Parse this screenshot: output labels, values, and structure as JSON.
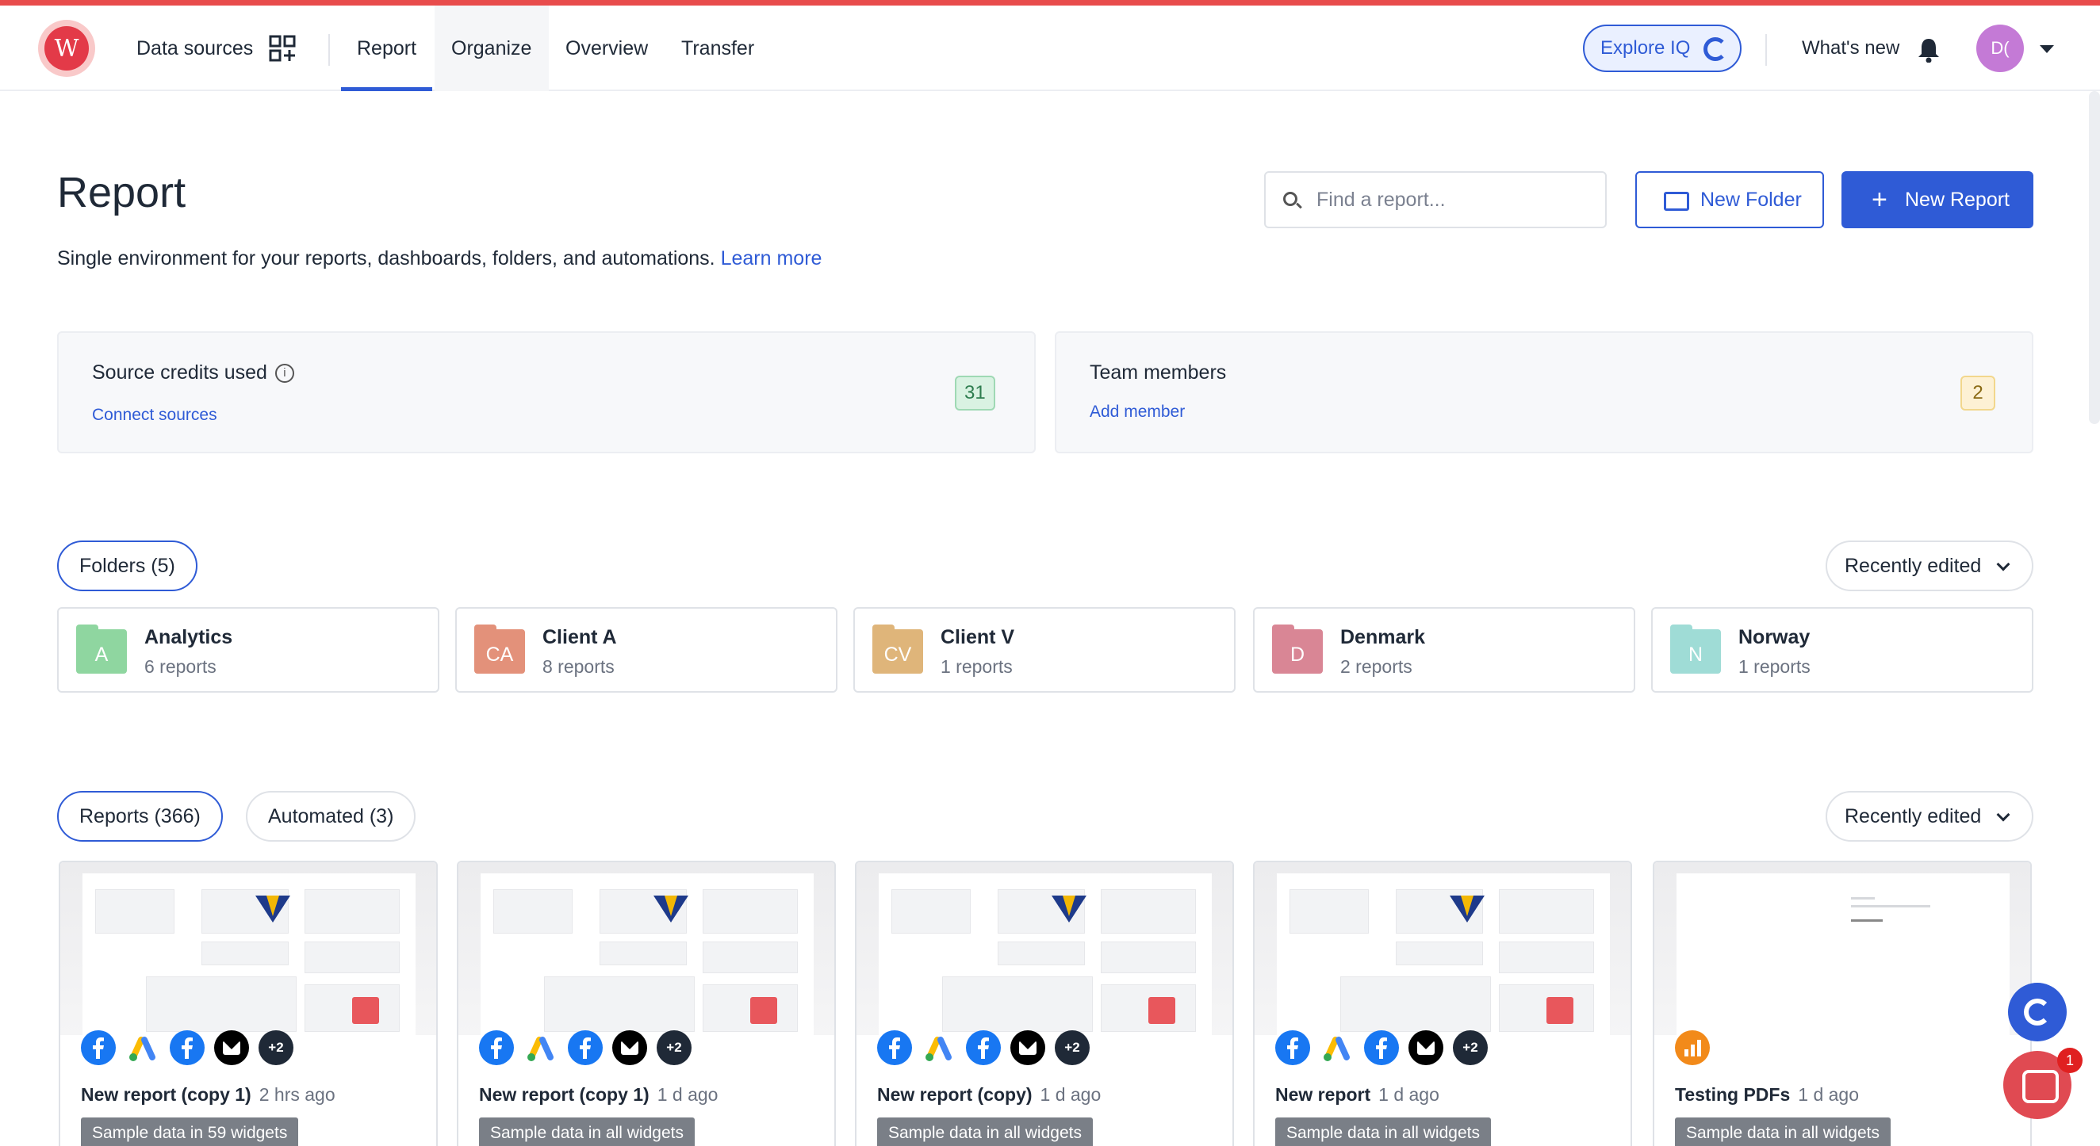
{
  "nav": {
    "logo_letter": "W",
    "data_sources": "Data sources",
    "items": [
      "Report",
      "Organize",
      "Overview",
      "Transfer"
    ],
    "explore_label": "Explore IQ",
    "whats_new": "What's new",
    "avatar_initials": "D("
  },
  "header": {
    "title": "Report",
    "subtitle": "Single environment for your reports, dashboards, folders, and automations.",
    "learn_more": "Learn more",
    "search_placeholder": "Find a report...",
    "new_folder": "New Folder",
    "new_report": "New Report"
  },
  "stats": {
    "credits": {
      "title": "Source credits used",
      "link": "Connect sources",
      "value": "31",
      "color": "#d9f2e2"
    },
    "team": {
      "title": "Team members",
      "link": "Add member",
      "value": "2",
      "color": "#fdf1d4"
    }
  },
  "folders": {
    "label": "Folders (5)",
    "sort": "Recently edited",
    "items": [
      {
        "initials": "A",
        "name": "Analytics",
        "count": "6 reports",
        "color": "#8fd6a0"
      },
      {
        "initials": "CA",
        "name": "Client A",
        "count": "8 reports",
        "color": "#e3917a"
      },
      {
        "initials": "CV",
        "name": "Client V",
        "count": "1 reports",
        "color": "#dfb57a"
      },
      {
        "initials": "D",
        "name": "Denmark",
        "count": "2 reports",
        "color": "#d98695"
      },
      {
        "initials": "N",
        "name": "Norway",
        "count": "1 reports",
        "color": "#9fdcd6"
      }
    ]
  },
  "reports": {
    "tabs": [
      "Reports (366)",
      "Automated (3)"
    ],
    "sort": "Recently edited",
    "items": [
      {
        "name": "New report (copy 1)",
        "time": "2 hrs ago",
        "tag": "Sample data in 59 widgets"
      },
      {
        "name": "New report (copy 1)",
        "time": "1 d ago",
        "tag": "Sample data in all widgets"
      },
      {
        "name": "New report (copy)",
        "time": "1 d ago",
        "tag": "Sample data in all widgets"
      },
      {
        "name": "New report",
        "time": "1 d ago",
        "tag": "Sample data in all widgets"
      },
      {
        "name": "Testing PDFs",
        "time": "1 d ago",
        "tag": "Sample data in all widgets"
      }
    ],
    "more_sources": "+2"
  },
  "chat": {
    "unread": "1"
  },
  "accent": "#2f5bd6",
  "icons": [
    "grid-plus-icon",
    "bell-icon",
    "search-icon",
    "folder-icon",
    "plus-icon",
    "info-icon",
    "chevron-down-icon",
    "facebook-icon",
    "google-ads-icon",
    "tiktok-icon",
    "chart-icon",
    "chat-icon"
  ]
}
